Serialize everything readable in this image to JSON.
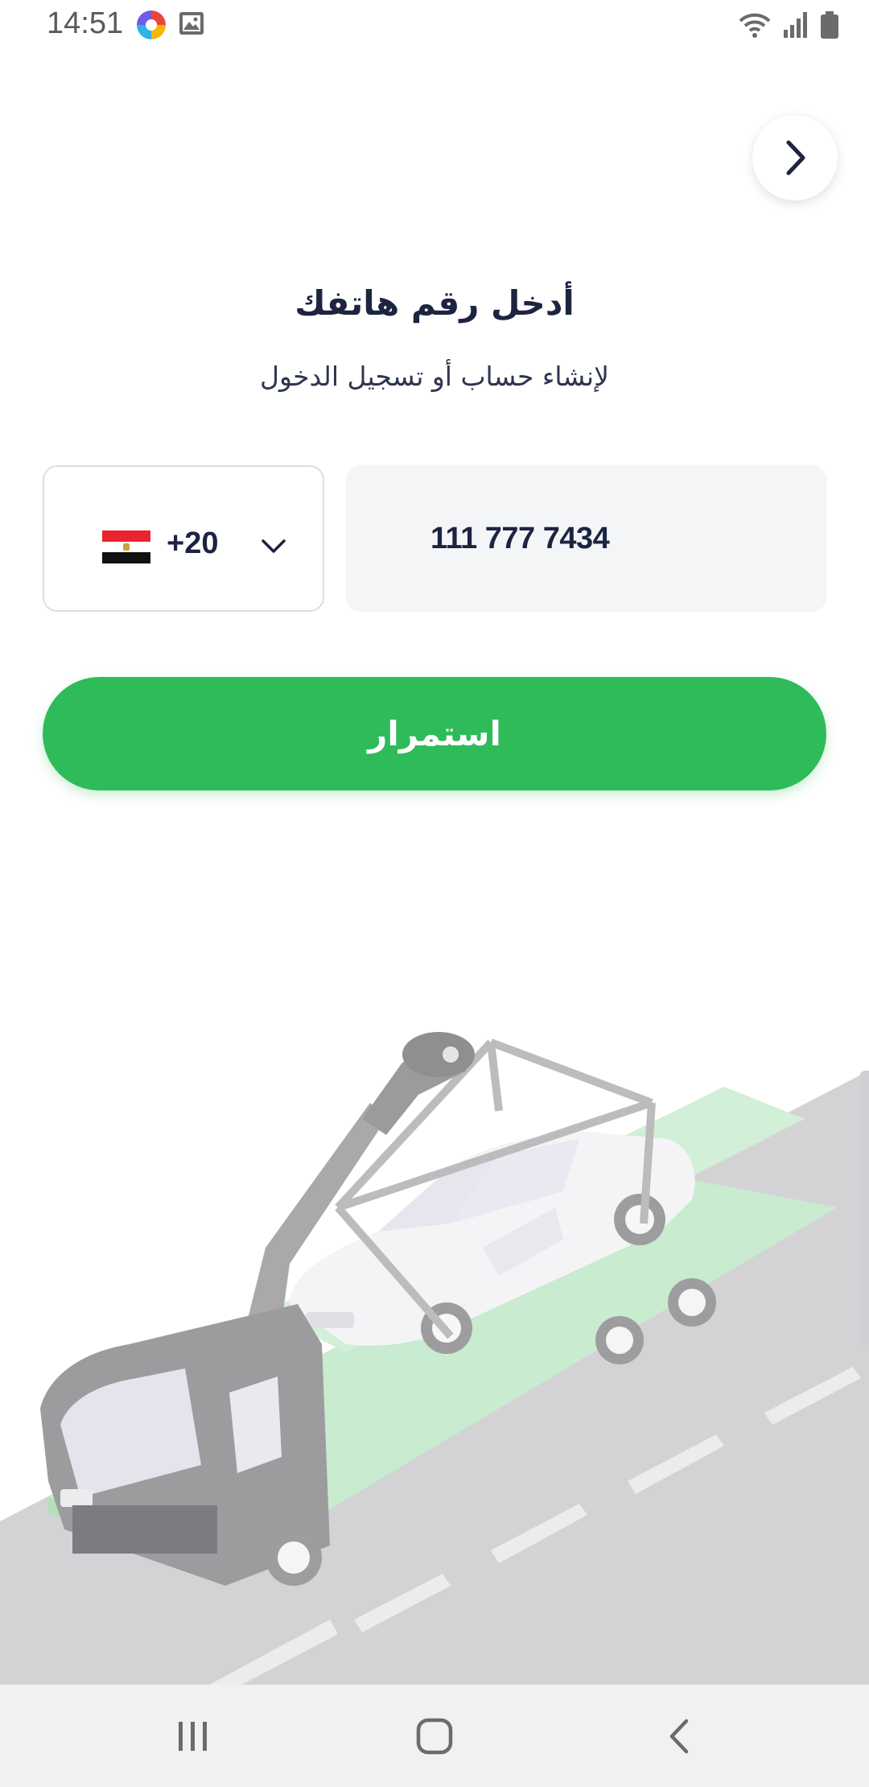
{
  "status_bar": {
    "time": "14:51",
    "icons": [
      "app-notification-icon",
      "gallery-icon",
      "wifi-icon",
      "signal-icon",
      "battery-icon"
    ]
  },
  "header": {
    "back_icon": "chevron-right-icon"
  },
  "title": "أدخل رقم هاتفك",
  "subtitle": "لإنشاء حساب أو تسجيل الدخول",
  "country_selector": {
    "flag": "egypt-flag",
    "dial_code": "+20",
    "dropdown_icon": "chevron-down-icon"
  },
  "phone_input": {
    "value": "111 777 7434"
  },
  "continue_button": {
    "label": "استمرار"
  },
  "illustration": "tow-truck-carrying-car",
  "colors": {
    "accent": "#2fbb59",
    "text_dark": "#1c2440",
    "input_bg": "#f4f5f7"
  },
  "nav_bar": {
    "icons": [
      "recent-apps-icon",
      "home-icon",
      "back-icon"
    ]
  }
}
